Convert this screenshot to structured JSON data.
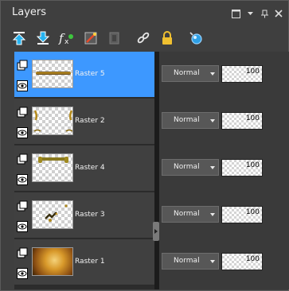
{
  "panel": {
    "title": "Layers",
    "title_controls": [
      "panel-menu-icon",
      "dropdown-arrow-icon",
      "pin-icon",
      "close-icon"
    ]
  },
  "toolbar": {
    "tools": [
      "move-layer-up-icon",
      "move-layer-down-icon",
      "layer-effects-icon",
      "visibility-toggle-icon",
      "mask-icon",
      "link-icon",
      "lock-icon",
      "properties-icon"
    ]
  },
  "layers": [
    {
      "name": "Raster 5",
      "blend_mode": "Normal",
      "opacity": "100",
      "selected": true
    },
    {
      "name": "Raster 2",
      "blend_mode": "Normal",
      "opacity": "100",
      "selected": false
    },
    {
      "name": "Raster 4",
      "blend_mode": "Normal",
      "opacity": "100",
      "selected": false
    },
    {
      "name": "Raster 3",
      "blend_mode": "Normal",
      "opacity": "100",
      "selected": false
    },
    {
      "name": "Raster 1",
      "blend_mode": "Normal",
      "opacity": "100",
      "selected": false
    }
  ],
  "colors": {
    "selection": "#3d98ff",
    "panel_bg": "#3f3f3f"
  }
}
